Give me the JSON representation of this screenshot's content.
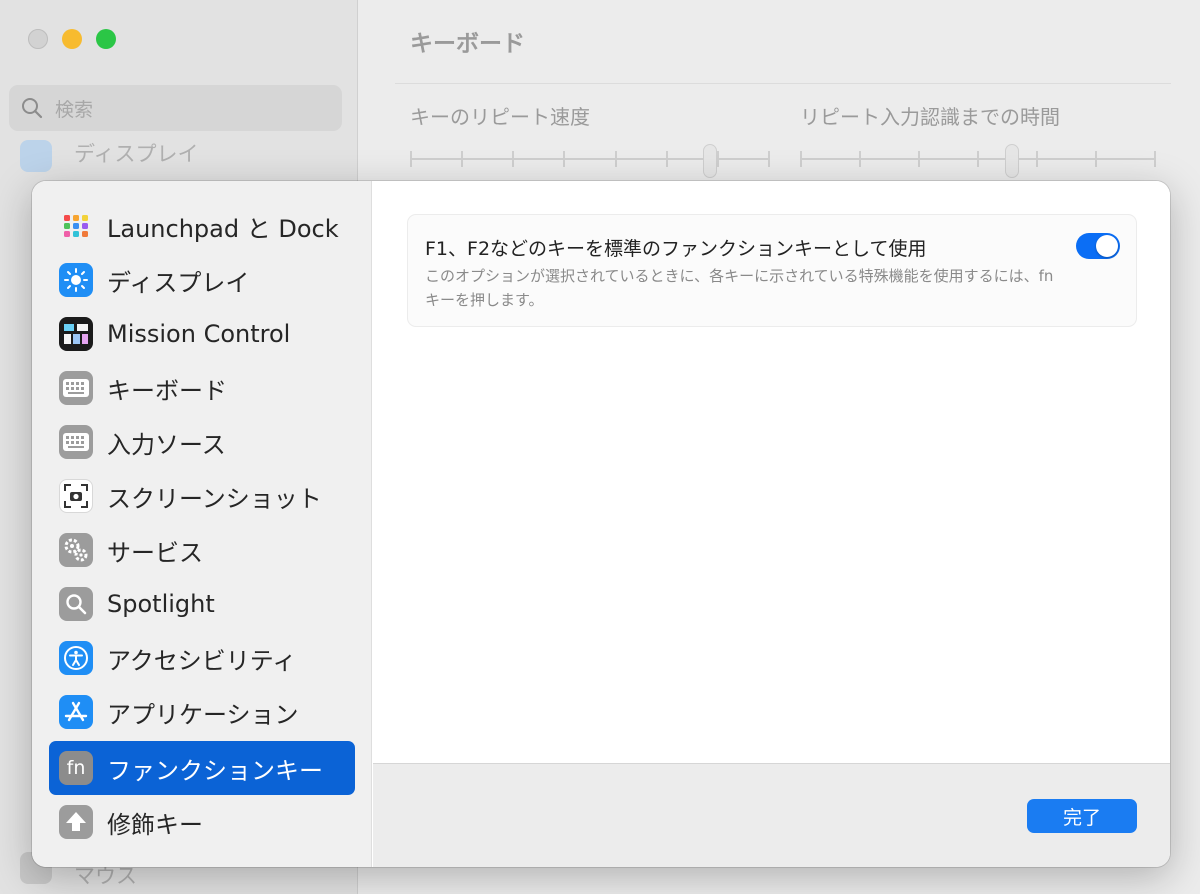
{
  "background": {
    "window_title": "キーボード",
    "search_placeholder": "検索",
    "peek_top": "ディスプレイ",
    "peek_bottom": "マウス",
    "key_repeat_label": "キーのリピート速度",
    "delay_label": "リピート入力認識までの時間"
  },
  "sidebar": {
    "items": [
      {
        "label": "Launchpad と Dock",
        "icon": "launchpad-icon"
      },
      {
        "label": "ディスプレイ",
        "icon": "display-brightness-icon"
      },
      {
        "label": "Mission Control",
        "icon": "mission-control-icon"
      },
      {
        "label": "キーボード",
        "icon": "keyboard-icon"
      },
      {
        "label": "入力ソース",
        "icon": "input-sources-icon"
      },
      {
        "label": "スクリーンショット",
        "icon": "screenshot-icon"
      },
      {
        "label": "サービス",
        "icon": "services-gear-icon"
      },
      {
        "label": "Spotlight",
        "icon": "spotlight-icon"
      },
      {
        "label": "アクセシビリティ",
        "icon": "accessibility-icon"
      },
      {
        "label": "アプリケーション",
        "icon": "app-store-icon"
      },
      {
        "label": "ファンクションキー",
        "icon": "fn-key-icon",
        "selected": true
      },
      {
        "label": "修飾キー",
        "icon": "modifier-keys-icon"
      }
    ],
    "fn_icon_text": "fn"
  },
  "option": {
    "title": "F1、F2などのキーを標準のファンクションキーとして使用",
    "description": "このオプションが選択されているときに、各キーに示されている特殊機能を使用するには、fnキーを押します。",
    "enabled": true
  },
  "footer": {
    "done_label": "完了"
  },
  "colors": {
    "accent": "#0b63d6",
    "toggle_on": "#0b6ef5",
    "button": "#1a7cf2"
  }
}
